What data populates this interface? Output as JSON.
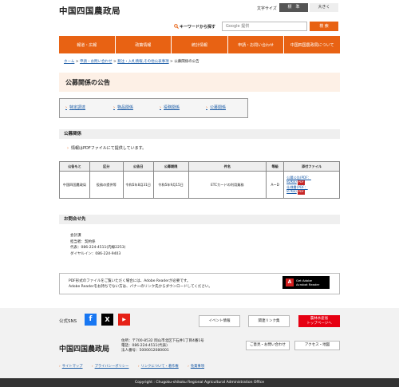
{
  "header": {
    "logo": "中国四国農政局",
    "fontsize_label": "文字サイズ",
    "fontsize_standard": "標　準",
    "fontsize_large": "大きく",
    "search_label": "キーワードから探す",
    "search_value": "Google 提供",
    "search_button": "検 索"
  },
  "nav": [
    "報道・広報",
    "政策情報",
    "統計情報",
    "申請・お問い合わせ",
    "中国四国農政局について"
  ],
  "breadcrumb": {
    "home": "ホーム",
    "sep": " > ",
    "level1": "申請・お問い合わせ",
    "level2": "発注・入札情報,その他公表事項",
    "current": "公募関係の公告"
  },
  "page_title": "公募関係の公告",
  "anchors": [
    "特定調達",
    "物品関係",
    "役務関係",
    "公募関係"
  ],
  "section1": {
    "heading": "公募関係",
    "notice": "情報はPDFファイルにて提供しています。"
  },
  "table": {
    "headers": [
      "公告もと",
      "区分",
      "公告日",
      "公募期限",
      "件名",
      "等級",
      "添付ファイル"
    ],
    "row": {
      "origin": "中国四国農政局",
      "category": "役務の提供等",
      "notice_date": "令和5年8月31日",
      "deadline": "令和5年9月15日",
      "subject": "ETCカードの利用業務",
      "grade": "A～D",
      "file1": "公募公告(PDF：",
      "file1_size": "82KB)",
      "file2": "仕様書(PDF：",
      "file2_size": "87KB)",
      "pdf_tag": "PDF"
    }
  },
  "section2": {
    "heading": "お問合せ先",
    "lines": [
      "会計課",
      "担当者：契約係",
      "代表：086-224-4511(内線2253)",
      "ダイヤルイン：086-224-9403"
    ]
  },
  "adobe": {
    "line1": "PDF形式のファイルをご覧いただく場合には、Adobe Readerが必要です。",
    "line2": "Adobe Readerをお持ちでない方は、バナーのリンク先からダウンロードしてください。",
    "badge_line1": "Get Adobe",
    "badge_line2": "Acrobat Reader"
  },
  "footer": {
    "sns_label": "公式SNS",
    "btn_event": "イベント情報",
    "btn_links": "関連リンク集",
    "btn_gov_line1": "農林水産省",
    "btn_gov_line2": "トップページへ",
    "logo": "中国四国農政局",
    "address_lines": [
      "住所：〒700-8532 岡山市北区下石井1丁目4番1号",
      "電話：086-224-4511(代表)",
      "法人番号：5000012080001"
    ],
    "btn_feedback": "ご意見・お問い合わせ",
    "btn_access": "アクセス・地図",
    "links": [
      "サイトマップ",
      "プライバシーポリシー",
      "リンクについて・著作権",
      "免責事項"
    ],
    "copyright": "Copyright : Chugoku-shikoku Regional Agricultural Administration Office"
  }
}
